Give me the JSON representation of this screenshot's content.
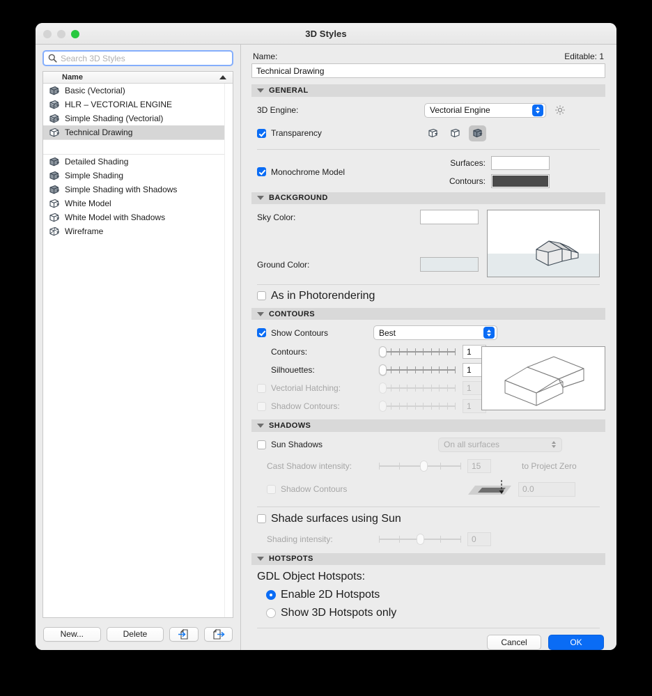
{
  "window": {
    "title": "3D Styles",
    "traffic_lights": [
      "close-disabled",
      "minimize-disabled",
      "zoom-green"
    ]
  },
  "sidebar": {
    "search": {
      "placeholder": "Search 3D Styles",
      "value": "",
      "icon": "search-icon"
    },
    "list_header": "Name",
    "sort_direction": "ascending",
    "items": [
      {
        "label": "Basic (Vectorial)",
        "icon": "style-solid-icon",
        "selected": false
      },
      {
        "label": "HLR – VECTORIAL ENGINE",
        "icon": "style-hatched-icon",
        "selected": false
      },
      {
        "label": "Simple Shading (Vectorial)",
        "icon": "style-hatched-icon",
        "selected": false
      },
      {
        "label": "Technical Drawing",
        "icon": "style-outline-icon",
        "selected": true
      }
    ],
    "items_group2": [
      {
        "label": "Detailed Shading",
        "icon": "style-solid-icon",
        "selected": false
      },
      {
        "label": "Simple Shading",
        "icon": "style-solid-icon",
        "selected": false
      },
      {
        "label": "Simple Shading with Shadows",
        "icon": "style-solid-icon",
        "selected": false
      },
      {
        "label": "White Model",
        "icon": "style-outline-icon",
        "selected": false
      },
      {
        "label": "White Model with Shadows",
        "icon": "style-outline-icon",
        "selected": false
      },
      {
        "label": "Wireframe",
        "icon": "style-wireframe-icon",
        "selected": false
      }
    ],
    "buttons": {
      "new": "New...",
      "delete": "Delete",
      "import_icon": "import-document-icon",
      "export_icon": "export-document-icon"
    }
  },
  "detail": {
    "name_label": "Name:",
    "editable_label": "Editable: 1",
    "name_value": "Technical Drawing",
    "general": {
      "title": "GENERAL",
      "engine_label": "3D Engine:",
      "engine_value": "Vectorial Engine",
      "gear_icon": "gear-icon",
      "transparency_label": "Transparency",
      "transparency_checked": true,
      "transparency_modes": [
        {
          "icon": "surface-open-icon",
          "active": false
        },
        {
          "icon": "surface-blank-icon",
          "active": false
        },
        {
          "icon": "surface-filled-icon",
          "active": true
        }
      ],
      "monochrome_label": "Monochrome Model",
      "monochrome_checked": true,
      "surfaces_label": "Surfaces:",
      "surfaces_color": "#ffffff",
      "contours_label": "Contours:",
      "contours_color": "#4a4a4a"
    },
    "background": {
      "title": "BACKGROUND",
      "sky_label": "Sky Color:",
      "sky_color": "#ffffff",
      "ground_label": "Ground Color:",
      "ground_color": "#e4eaec",
      "link_icon": "chain-link-icon",
      "preview_name": "background-preview",
      "as_in_photorendering_label": "As in Photorendering",
      "as_in_photorendering_checked": false
    },
    "contours": {
      "title": "CONTOURS",
      "show_contours_label": "Show Contours",
      "show_contours_checked": true,
      "quality_value": "Best",
      "rows": [
        {
          "label": "Contours:",
          "value": "1",
          "enabled": true,
          "checkbox": false,
          "knob_pct": 0
        },
        {
          "label": "Silhouettes:",
          "value": "1",
          "enabled": true,
          "checkbox": false,
          "knob_pct": 0
        },
        {
          "label": "Vectorial Hatching:",
          "value": "1",
          "enabled": false,
          "checkbox": true,
          "checked": false,
          "knob_pct": 0
        },
        {
          "label": "Shadow Contours:",
          "value": "1",
          "enabled": false,
          "checkbox": true,
          "checked": false,
          "knob_pct": 0
        }
      ],
      "preview_name": "contours-preview"
    },
    "shadows": {
      "title": "SHADOWS",
      "sun_shadows_label": "Sun Shadows",
      "sun_shadows_checked": false,
      "surfaces_mode_value": "On all surfaces",
      "cast_intensity_label": "Cast Shadow intensity:",
      "cast_intensity_value": "15",
      "cast_intensity_pct": 50,
      "shadow_contours_label": "Shadow Contours",
      "shadow_contours_checked": false,
      "to_project_zero_label": "to Project Zero",
      "project_zero_value": "0.0",
      "shadow_glyph": "shadow-plane-icon",
      "shade_surfaces_label": "Shade surfaces using Sun",
      "shade_surfaces_checked": false,
      "shading_intensity_label": "Shading intensity:",
      "shading_intensity_value": "0",
      "shading_intensity_pct": 46
    },
    "hotspots": {
      "title": "HOTSPOTS",
      "gdl_label": "GDL Object Hotspots:",
      "option_2d": "Enable 2D Hotspots",
      "option_3d": "Show 3D Hotspots only",
      "selected": "2d"
    },
    "footer": {
      "cancel": "Cancel",
      "ok": "OK"
    }
  },
  "colors": {
    "accent": "#0a6cf5",
    "section_header_bg": "#d9d9d9",
    "window_bg": "#ececec",
    "selection_bg": "#d6d6d6"
  }
}
